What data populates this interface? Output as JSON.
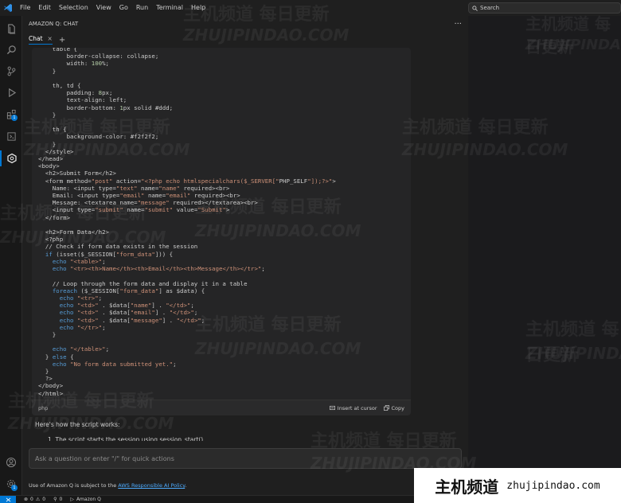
{
  "menu": [
    "File",
    "Edit",
    "Selection",
    "View",
    "Go",
    "Run",
    "Terminal",
    "Help"
  ],
  "search": {
    "label": "Search"
  },
  "panel": {
    "title": "AMAZON Q: CHAT",
    "more": "···"
  },
  "tabs": [
    {
      "label": "Chat",
      "close": "×"
    }
  ],
  "new_tab": "+",
  "activity": {
    "extensions_badge": "1",
    "account_badge": "1"
  },
  "code": {
    "lines": [
      "    table {",
      "        border-collapse: collapse;",
      "        width: 100%;",
      "    }",
      "",
      "    th, td {",
      "        padding: 8px;",
      "        text-align: left;",
      "        border-bottom: 1px solid #ddd;",
      "    }",
      "",
      "    th {",
      "        background-color: #f2f2f2;",
      "    }",
      "  </style>",
      "</head>",
      "<body>",
      "  <h2>Submit Form</h2>",
      "  <form method=\"post\" action=\"<?php echo htmlspecialchars($_SERVER[\"PHP_SELF\"]);?>\">",
      "    Name: <input type=\"text\" name=\"name\" required><br>",
      "    Email: <input type=\"email\" name=\"email\" required><br>",
      "    Message: <textarea name=\"message\" required></textarea><br>",
      "    <input type=\"submit\" name=\"submit\" value=\"Submit\">",
      "  </form>",
      "",
      "  <h2>Form Data</h2>",
      "  <?php",
      "  // Check if form data exists in the session",
      "  if (isset($_SESSION[\"form_data\"])) {",
      "    echo \"<table>\";",
      "    echo \"<tr><th>Name</th><th>Email</th><th>Message</th></tr>\";",
      "",
      "    // Loop through the form data and display it in a table",
      "    foreach ($_SESSION[\"form_data\"] as $data) {",
      "      echo \"<tr>\";",
      "      echo \"<td>\" . $data[\"name\"] . \"</td>\";",
      "      echo \"<td>\" . $data[\"email\"] . \"</td>\";",
      "      echo \"<td>\" . $data[\"message\"] . \"</td>\";",
      "      echo \"</tr>\";",
      "    }",
      "",
      "    echo \"</table>\";",
      "  } else {",
      "    echo \"No form data submitted yet.\";",
      "  }",
      "  ?>",
      "</body>",
      "</html>"
    ],
    "language": "php",
    "insert_label": "Insert at cursor",
    "copy_label": "Copy"
  },
  "explanation": "Here's how the script works:",
  "step_1": "1. The script starts the session using session_start().",
  "ask": {
    "placeholder": "Ask a question or enter \"/\" for quick actions"
  },
  "policy": {
    "prefix": "Use of Amazon Q is subject to the ",
    "link": "AWS Responsible AI Policy",
    "suffix": "."
  },
  "status": {
    "errors": "0",
    "warnings": "0",
    "ports": "0",
    "extension": "Amazon Q"
  },
  "watermark": {
    "cn": "主机频道 每日更新",
    "en": "ZHUJIPINDAO.COM",
    "brand_cn": "主机频道",
    "brand_url": "zhujipindao.com"
  },
  "colors": {
    "accent": "#0078d4",
    "link": "#4daafc"
  }
}
